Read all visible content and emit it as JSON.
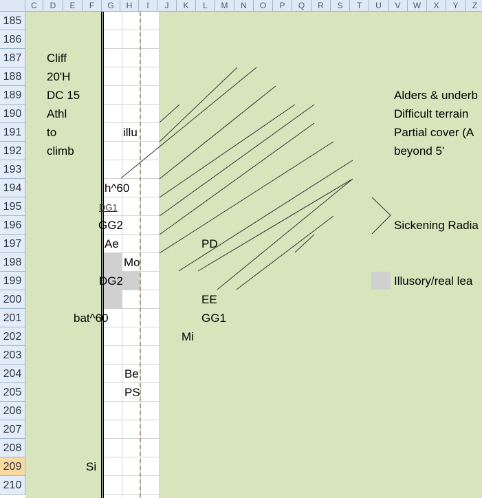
{
  "column_headers": [
    "C",
    "D",
    "E",
    "F",
    "G",
    "H",
    "I",
    "J",
    "K",
    "L",
    "M",
    "N",
    "O",
    "P",
    "Q",
    "R",
    "S",
    "T",
    "U",
    "V",
    "W",
    "X",
    "Y",
    "Z"
  ],
  "row_numbers": [
    "185",
    "186",
    "187",
    "188",
    "189",
    "190",
    "191",
    "192",
    "193",
    "194",
    "195",
    "196",
    "197",
    "198",
    "199",
    "200",
    "201",
    "202",
    "203",
    "204",
    "205",
    "206",
    "207",
    "208",
    "209",
    "210"
  ],
  "selected_row": "209",
  "cells": {
    "cliff_lines": [
      "Cliff",
      "20'H",
      "DC 15",
      "Athl",
      "to",
      "climb"
    ],
    "illu": "illu",
    "h60": "h^60",
    "dg1": "DG1",
    "gg2": "GG2",
    "ae": "Ae",
    "mo": "Mo",
    "dg2": "DG2",
    "bat60": "bat^60",
    "pd": "PD",
    "ee": "EE",
    "gg1": "GG1",
    "mi": "Mi",
    "be": "Be",
    "ps": "PS",
    "si": "Si"
  },
  "legend": {
    "alders_lines": [
      "Alders & underb",
      "Difficult terrain",
      "Partial cover (A",
      "beyond 5'"
    ],
    "sickening": "Sickening Radia",
    "illusory": "Illusory/real lea"
  },
  "colors": {
    "terrain_green": "#d8e4bc",
    "header_bg": "#dfe8f5",
    "selected_row_bg": "#f9d99f",
    "illusory_gray": "#d0d0d0"
  }
}
